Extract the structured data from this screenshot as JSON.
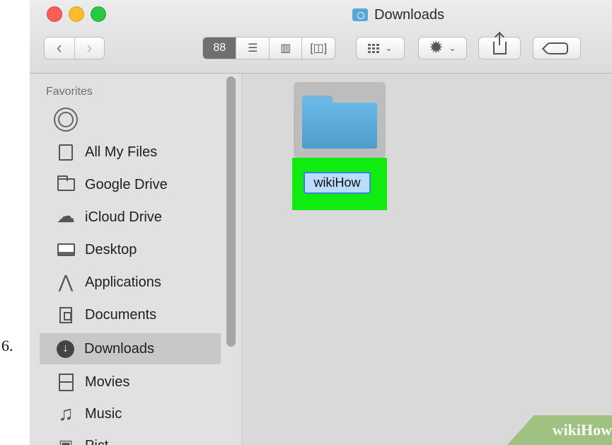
{
  "step": {
    "number": "6."
  },
  "window": {
    "title": "Downloads",
    "title_icon": "downloads-folder-icon"
  },
  "toolbar": {
    "navigation": {
      "back": "‹",
      "forward": "›"
    },
    "view_modes": [
      {
        "name": "icon-view",
        "glyph": "88"
      },
      {
        "name": "list-view",
        "glyph": "☰"
      },
      {
        "name": "column-view",
        "glyph": "▥"
      },
      {
        "name": "cover-flow-view",
        "glyph": "[◫]"
      }
    ],
    "arrange_icon": "arrange-grid-icon",
    "dropdown_arrow": "⌄",
    "action_icon": "gear-icon",
    "share_icon": "share-icon",
    "tag_icon": "tag-icon"
  },
  "sidebar": {
    "heading": "Favorites",
    "items": [
      {
        "label": "",
        "icon": "airdrop-icon"
      },
      {
        "label": "All My Files",
        "icon": "all-my-files-icon"
      },
      {
        "label": "Google Drive",
        "icon": "folder-icon"
      },
      {
        "label": "iCloud Drive",
        "icon": "cloud-icon"
      },
      {
        "label": "Desktop",
        "icon": "desktop-icon"
      },
      {
        "label": "Applications",
        "icon": "applications-icon"
      },
      {
        "label": "Documents",
        "icon": "documents-icon"
      },
      {
        "label": "Downloads",
        "icon": "downloads-icon",
        "selected": true
      },
      {
        "label": "Movies",
        "icon": "movies-icon"
      },
      {
        "label": "Music",
        "icon": "music-icon"
      },
      {
        "label": "Pict",
        "icon": "pictures-icon"
      }
    ]
  },
  "content": {
    "folder_name": "wikiHow",
    "highlight_color": "#10ec10",
    "folder_color": "#58a7da"
  },
  "watermark": {
    "wiki": "wiki",
    "how": "How"
  }
}
